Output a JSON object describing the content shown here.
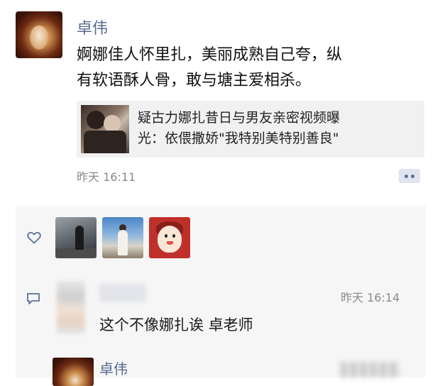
{
  "post": {
    "author": "卓伟",
    "text_lines": [
      "婀娜佳人怀里扎，美丽成熟自己夸，纵",
      "有软语酥人骨，敢与塘主爱相杀。"
    ],
    "link_card": {
      "title_lines": [
        "疑古力娜扎昔日与男友亲密视频曝",
        "光：依偎撒娇\"我特别美特别善良\""
      ]
    },
    "timestamp": "昨天 16:11"
  },
  "feedback": {
    "like_icon": "heart-outline-icon",
    "comment_icon": "comment-bubble-icon",
    "comment": {
      "time": "昨天 16:14",
      "text": "这个不像娜扎诶 卓老师"
    },
    "reply": {
      "name": "卓伟"
    }
  },
  "colors": {
    "name_link": "#586a90",
    "meta_gray": "#8a8a8a",
    "panel_bg": "#f6f6f6"
  }
}
